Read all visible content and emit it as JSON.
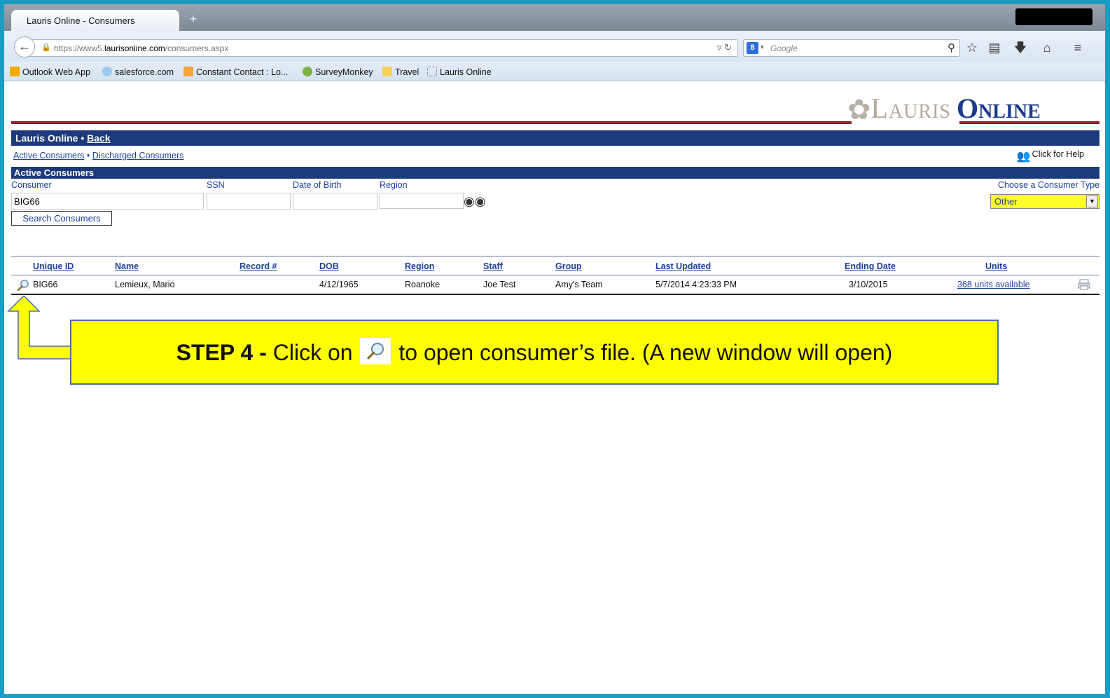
{
  "browser": {
    "tab_title": "Lauris Online - Consumers",
    "new_tab": "+",
    "url_prefix": "https://www5.",
    "url_domain": "laurisonline.com",
    "url_path": "/consumers.aspx",
    "search_engine": "Google",
    "bookmarks": [
      "Outlook Web App",
      "salesforce.com",
      "Constant Contact : Lo...",
      "SurveyMonkey",
      "Travel",
      "Lauris Online"
    ]
  },
  "app": {
    "logo_part1": "Lauris",
    "logo_part2": "Online",
    "topbar_title": "Lauris Online",
    "topbar_sep": " • ",
    "back_label": "Back",
    "subnav_active": "Active Consumers",
    "subnav_sep": " • ",
    "subnav_discharged": "Discharged Consumers",
    "help_label": "Click for Help",
    "section_title": "Active Consumers"
  },
  "search": {
    "consumer_label": "Consumer",
    "consumer_value": "BIG66",
    "ssn_label": "SSN",
    "ssn_value": "",
    "dob_label": "Date of Birth",
    "dob_value": "",
    "region_label": "Region",
    "region_value": "",
    "button_label": "Search Consumers",
    "type_label": "Choose a Consumer Type",
    "type_value": "Other"
  },
  "table": {
    "headers": [
      "Unique ID",
      "Name",
      "Record #",
      "DOB",
      "Region",
      "Staff",
      "Group",
      "Last Updated",
      "Ending Date",
      "Units"
    ],
    "rows": [
      {
        "unique_id": "BIG66",
        "name": "Lemieux, Mario",
        "record": "",
        "dob": "4/12/1965",
        "region": "Roanoke",
        "staff": "Joe Test",
        "group": "Amy's Team",
        "last_updated": "5/7/2014 4:23:33 PM",
        "ending_date": "3/10/2015",
        "units": "368 units available"
      }
    ]
  },
  "callout": {
    "step": "STEP 4 -",
    "text_before": " Click on ",
    "text_after": " to open consumer’s file. (A new window will open)"
  },
  "colors": {
    "navy_bar": "#1d3a7c",
    "callout_yellow": "#ffff00",
    "select_yellow": "#ffff2e",
    "link_blue": "#1b3f9c",
    "frame_teal": "#1a9cc3"
  }
}
